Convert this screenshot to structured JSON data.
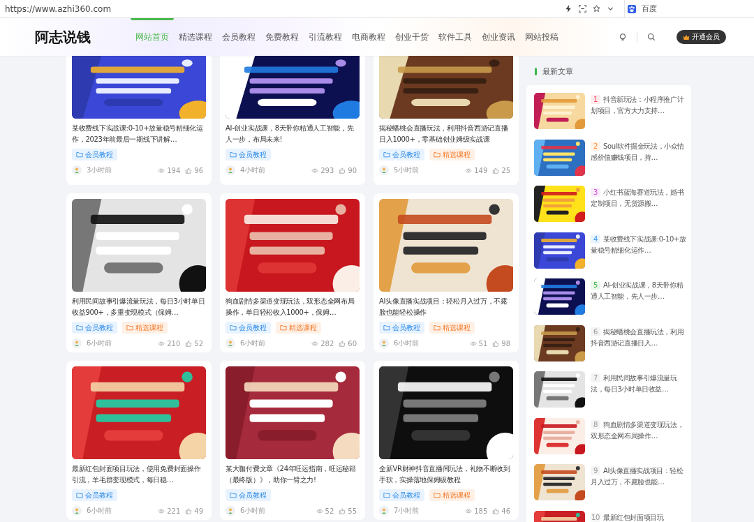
{
  "browser": {
    "url": "https://www.azhi360.com",
    "search_placeholder": "百度"
  },
  "site": {
    "logo": "阿志说钱",
    "vip_button": "开通会员",
    "nav": [
      {
        "label": "网站首页",
        "selected": true
      },
      {
        "label": "精选课程",
        "selected": false
      },
      {
        "label": "会员教程",
        "selected": false
      },
      {
        "label": "免费教程",
        "selected": false
      },
      {
        "label": "引流教程",
        "selected": false
      },
      {
        "label": "电商教程",
        "selected": false
      },
      {
        "label": "创业干货",
        "selected": false
      },
      {
        "label": "软件工具",
        "selected": false
      },
      {
        "label": "创业资讯",
        "selected": false
      },
      {
        "label": "网站投稿",
        "selected": false
      }
    ]
  },
  "articles": [
    {
      "title": "某收费线下实战课:0-10+放量稳号精细化运作，2023年前最后一期线下讲解…",
      "tags": [
        {
          "kind": "member",
          "label": "会员教程"
        }
      ],
      "time": "3小时前",
      "views": "194",
      "likes": "96"
    },
    {
      "title": "AI-创业实战课，8天带你精通人工智能，先人一步，布局未来!",
      "tags": [
        {
          "kind": "member",
          "label": "会员教程"
        }
      ],
      "time": "4小时前",
      "views": "293",
      "likes": "90"
    },
    {
      "title": "揭秘蟠桃会直播玩法，利用抖音西游记直播日入1000+，零基础创业姆级实战课",
      "tags": [
        {
          "kind": "member",
          "label": "会员教程"
        },
        {
          "kind": "featured",
          "label": "精选课程"
        }
      ],
      "time": "5小时前",
      "views": "149",
      "likes": "25"
    },
    {
      "title": "利用民间故事引爆流量玩法，每日3小时单日收益900+，多重变现模式（保姆…",
      "tags": [
        {
          "kind": "member",
          "label": "会员教程"
        },
        {
          "kind": "featured",
          "label": "精选课程"
        }
      ],
      "time": "6小时前",
      "views": "210",
      "likes": "52"
    },
    {
      "title": "狗血剧情多渠道变现玩法，双形态全网布局操作，单日轻松收入1000+，保姆…",
      "tags": [
        {
          "kind": "member",
          "label": "会员教程"
        },
        {
          "kind": "featured",
          "label": "精选课程"
        }
      ],
      "time": "6小时前",
      "views": "282",
      "likes": "60"
    },
    {
      "title": "AI头像直播实战项目：轻松月入过万，不露脸也能轻松操作",
      "tags": [
        {
          "kind": "member",
          "label": "会员教程"
        },
        {
          "kind": "featured",
          "label": "精选课程"
        }
      ],
      "time": "6小时前",
      "views": "51",
      "likes": "98"
    },
    {
      "title": "最新红包封面项目玩法，使用免费封面操作引流，羊毛群变现模式，每日稳…",
      "tags": [
        {
          "kind": "member",
          "label": "会员教程"
        }
      ],
      "time": "6小时前",
      "views": "221",
      "likes": "49"
    },
    {
      "title": "某大咖付费文章《24年旺运指南，旺运秘籍（最终版）》，助你一臂之力!",
      "tags": [
        {
          "kind": "member",
          "label": "会员教程"
        }
      ],
      "time": "6小时前",
      "views": "52",
      "likes": "55"
    },
    {
      "title": "全新VR财神抖音直播间玩法，礼物不断收到手软，实操落地保姆级教程",
      "tags": [
        {
          "kind": "member",
          "label": "会员教程"
        },
        {
          "kind": "featured",
          "label": "精选课程"
        }
      ],
      "time": "7小时前",
      "views": "185",
      "likes": "46"
    }
  ],
  "sidebar": {
    "title": "最新文章",
    "items": [
      {
        "rank": "1",
        "color": "#f5475d",
        "title": "抖音新玩法：小程序推广计划项目，官方大力支持…"
      },
      {
        "rank": "2",
        "color": "#ff8c3b",
        "title": "Soul软件掘金玩法，小众情感价值赚钱项目，持…"
      },
      {
        "rank": "3",
        "color": "#d64be0",
        "title": "小红书蓝海赛道玩法，婚书定制项目，无货源搬…"
      },
      {
        "rank": "4",
        "color": "#3a9bf5",
        "title": "某收费线下实战课:0-10+放量稳号精细化运作…"
      },
      {
        "rank": "5",
        "color": "#3cb54a",
        "title": "AI-创业实战课，8天带你精通人工智能，先人一步…"
      },
      {
        "rank": "6",
        "color": "#999999",
        "title": "揭秘蟠桃会直播玩法，利用抖音西游记直播日入…"
      },
      {
        "rank": "7",
        "color": "#999999",
        "title": "利用民间故事引爆流量玩法，每日3小时单日收益…"
      },
      {
        "rank": "8",
        "color": "#999999",
        "title": "狗血剧情多渠道变现玩法，双形态全网布局操作…"
      },
      {
        "rank": "9",
        "color": "#999999",
        "title": "AI头像直播实战项目：轻松月入过万，不露脸也能…"
      },
      {
        "rank": "10",
        "color": "#999999",
        "title": "最新红包封面项目玩"
      }
    ]
  }
}
